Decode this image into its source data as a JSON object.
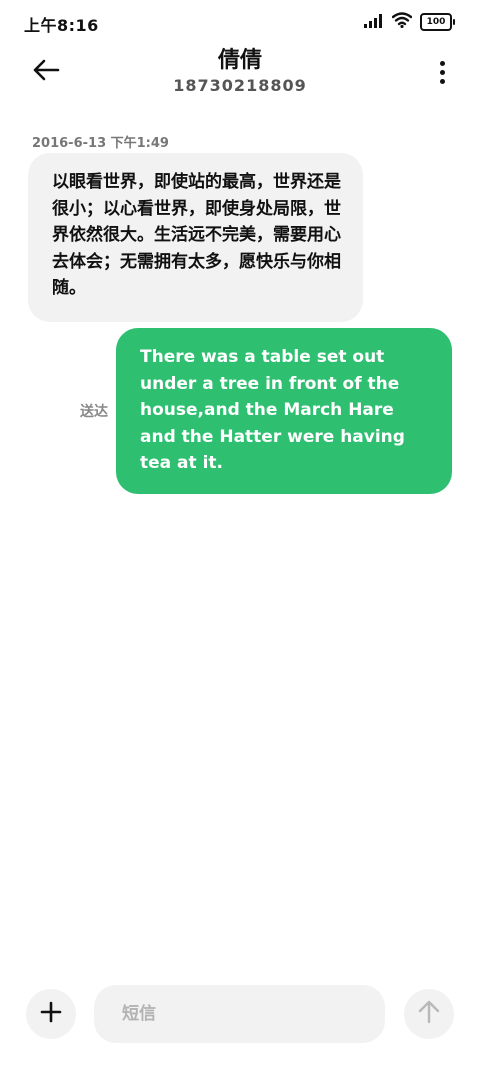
{
  "status_bar": {
    "time": "上午8:16",
    "battery": "100",
    "icons": [
      "signal-icon",
      "wifi-icon",
      "battery-icon"
    ]
  },
  "header": {
    "contact_name": "倩倩",
    "contact_number": "18730218809",
    "back_icon": "back-arrow-icon",
    "more_icon": "more-vertical-icon"
  },
  "conversation": {
    "timestamp": "2016-6-13 下午1:49",
    "received_message": "以眼看世界，即使站的最高，世界还是很小；以心看世界，即使身处局限，世界依然很大。生活远不完美，需要用心去体会；无需拥有太多，愿快乐与你相随。",
    "sent_message": "There was a table set out under a tree in front of the house,and the March Hare and the Hatter were having tea at it.",
    "sent_status": "送达"
  },
  "composer": {
    "placeholder": "短信",
    "add_icon": "plus-icon",
    "send_icon": "arrow-up-icon"
  },
  "colors": {
    "sent_bubble": "#2fbf71",
    "received_bubble": "#f2f2f2",
    "background": "#ffffff"
  }
}
